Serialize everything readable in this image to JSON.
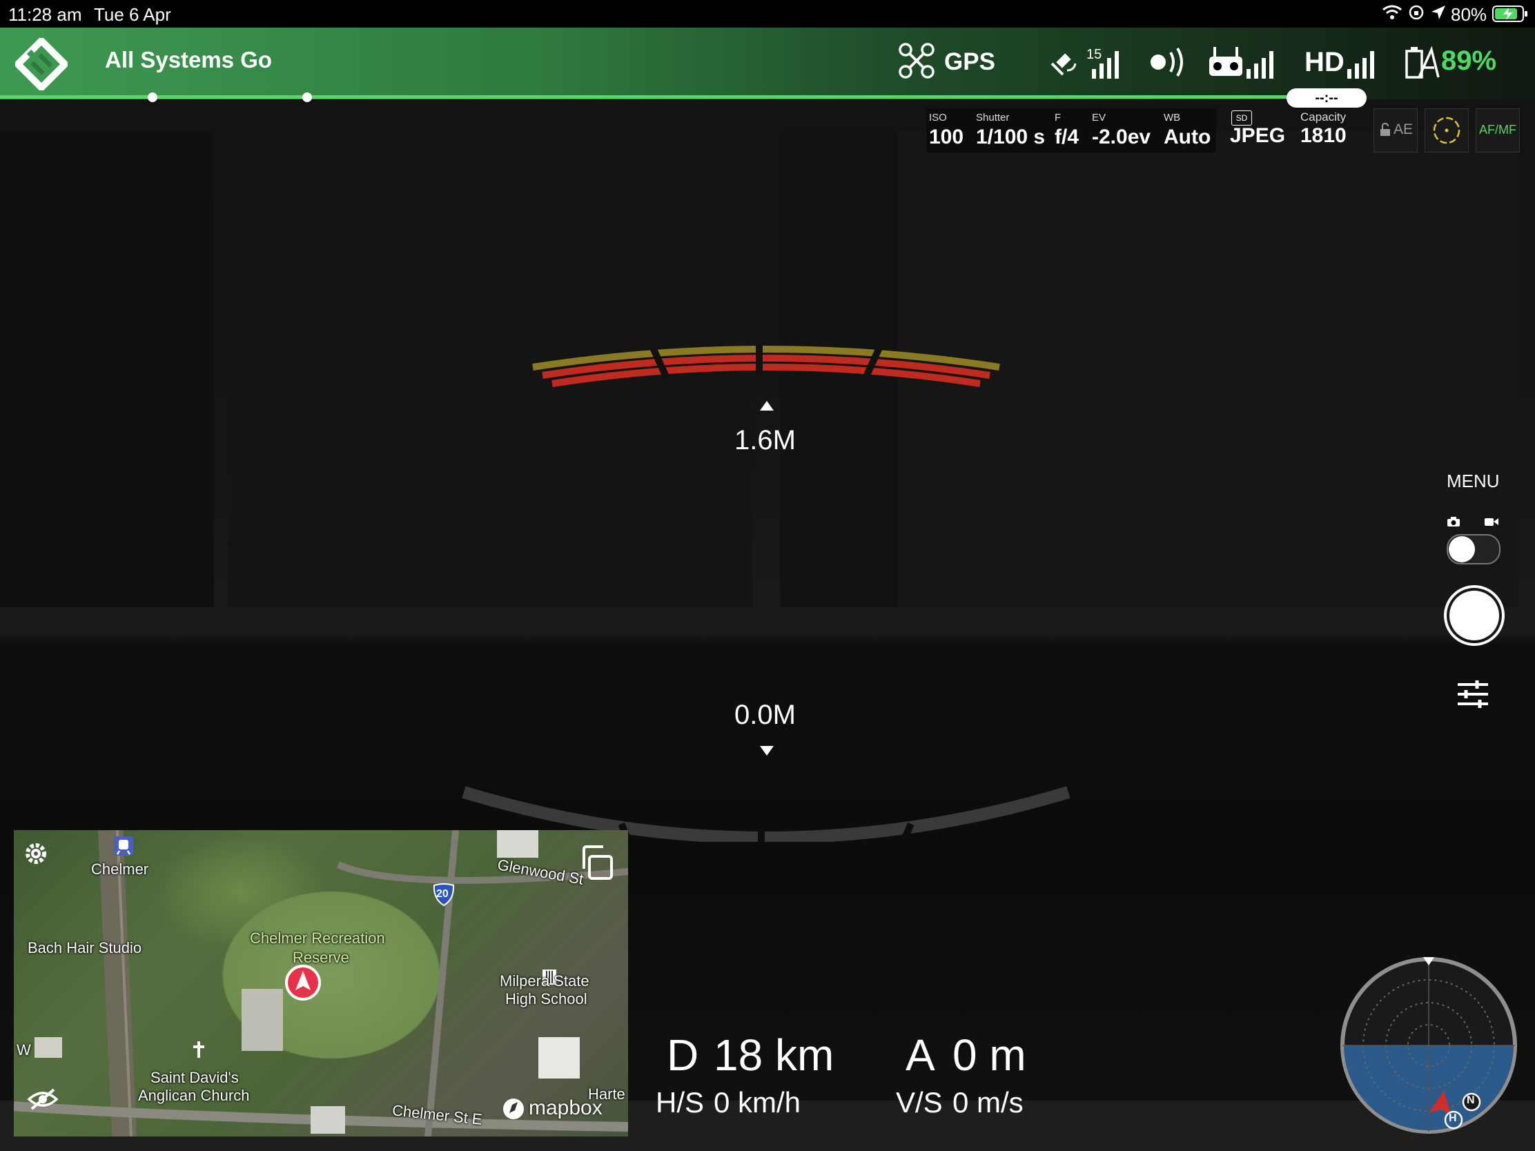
{
  "status_bar": {
    "time": "11:28 am",
    "date": "Tue 6 Apr",
    "battery": "80%"
  },
  "header": {
    "status_text": "All Systems Go",
    "gps_label": "GPS",
    "satellite_count": "15",
    "video_quality": "HD",
    "aircraft_battery": "89%",
    "timer": "--:--"
  },
  "camera": {
    "iso": {
      "label": "ISO",
      "value": "100"
    },
    "shutter": {
      "label": "Shutter",
      "value": "1/100 s"
    },
    "aperture": {
      "label": "F",
      "value": "f/4"
    },
    "ev": {
      "label": "EV",
      "value": "-2.0ev"
    },
    "wb": {
      "label": "WB",
      "value": "Auto"
    },
    "format": {
      "label": "SD",
      "value": "JPEG"
    },
    "capacity": {
      "label": "Capacity",
      "value": "1810"
    },
    "ae_label": "AE",
    "afmf_label": "AF/MF"
  },
  "obstacle": {
    "upper_distance": "1.6M",
    "lower_distance": "0.0M"
  },
  "right_panel": {
    "menu_label": "MENU"
  },
  "telemetry": {
    "distance_label": "D",
    "distance_value": "18 km",
    "altitude_label": "A",
    "altitude_value": "0 m",
    "hs_label": "H/S",
    "hs_value": "0 km/h",
    "vs_label": "V/S",
    "vs_value": "0 m/s"
  },
  "map": {
    "labels": {
      "chelmer": "Chelmer",
      "glenwood": "Glenwood St",
      "route": "20",
      "recreation_1": "Chelmer Recreation",
      "recreation_2": "Reserve",
      "bach": "Bach Hair Studio",
      "milpera_1": "Milpera State",
      "milpera_2": "High School",
      "saint_1": "Saint David's",
      "saint_2": "Anglican Church",
      "chelmer_st": "Chelmer St E",
      "west": "W",
      "harte": "Harte",
      "attribution": "mapbox"
    }
  },
  "compass": {
    "north": "N",
    "home": "H"
  },
  "colors": {
    "accent_green": "#59d66a",
    "battery_green": "#4cd964",
    "map_blue": "#2c5a8a"
  }
}
